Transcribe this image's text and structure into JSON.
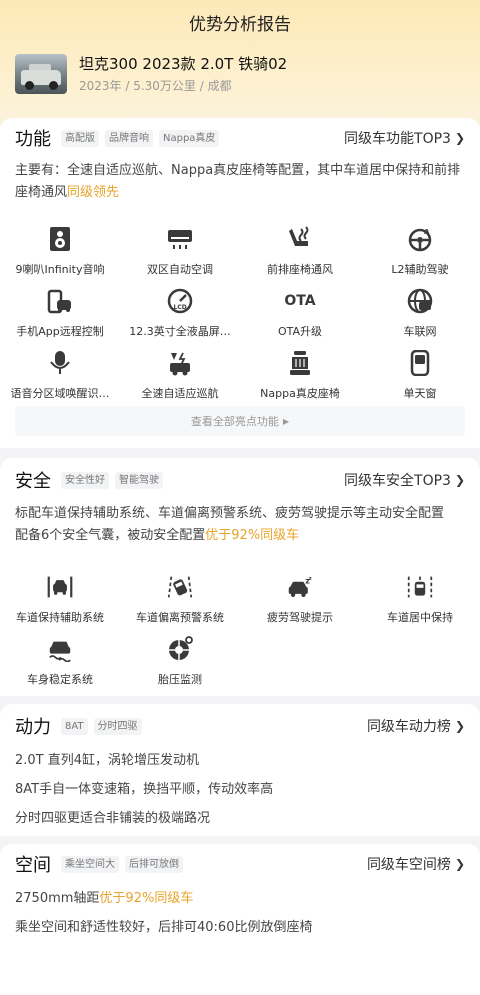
{
  "page_title": "优势分析报告",
  "car": {
    "name": "坦克300 2023款 2.0T 铁骑02",
    "meta": "2023年 / 5.30万公里 / 成都"
  },
  "features": {
    "title": "功能",
    "tags": [
      "高配版",
      "品牌音响",
      "Nappa真皮"
    ],
    "link": "同级车功能TOP3",
    "summary_main": "主要有：全速自适应巡航、Nappa真皮座椅等配置，其中车道居中保持和前排座椅通风",
    "summary_hl": "同级领先",
    "items": [
      {
        "label": "9喇叭Infinity音响",
        "icon": "speaker-icon"
      },
      {
        "label": "双区自动空调",
        "icon": "air-conditioner-icon"
      },
      {
        "label": "前排座椅通风",
        "icon": "seat-ventilation-icon"
      },
      {
        "label": "L2辅助驾驶",
        "icon": "assisted-driving-icon"
      },
      {
        "label": "手机App远程控制",
        "icon": "phone-remote-icon"
      },
      {
        "label": "12.3英寸全液晶屏…",
        "icon": "lcd-gauge-icon"
      },
      {
        "label": "OTA升级",
        "icon": "ota-icon"
      },
      {
        "label": "车联网",
        "icon": "connected-car-icon"
      },
      {
        "label": "语音分区域唤醒识…",
        "icon": "microphone-icon"
      },
      {
        "label": "全速自适应巡航",
        "icon": "adaptive-cruise-icon"
      },
      {
        "label": "Nappa真皮座椅",
        "icon": "leather-seat-icon"
      },
      {
        "label": "单天窗",
        "icon": "sunroof-icon"
      }
    ],
    "ota_text": "OTA",
    "lcd_text": "LCD",
    "see_all": "查看全部亮点功能"
  },
  "safety": {
    "title": "安全",
    "tags": [
      "安全性好",
      "智能驾驶"
    ],
    "link": "同级车安全TOP3",
    "line1": "标配车道保持辅助系统、车道偏离预警系统、疲劳驾驶提示等主动安全配置",
    "line2_main": "配备6个安全气囊，被动安全配置",
    "line2_hl": "优于92%同级车",
    "items": [
      {
        "label": "车道保持辅助系统",
        "icon": "lane-keep-icon"
      },
      {
        "label": "车道偏离预警系统",
        "icon": "lane-departure-icon"
      },
      {
        "label": "疲劳驾驶提示",
        "icon": "fatigue-alert-icon"
      },
      {
        "label": "车道居中保持",
        "icon": "lane-centering-icon"
      },
      {
        "label": "车身稳定系统",
        "icon": "stability-control-icon"
      },
      {
        "label": "胎压监测",
        "icon": "tire-pressure-icon"
      }
    ]
  },
  "power": {
    "title": "动力",
    "tags": [
      "8AT",
      "分时四驱"
    ],
    "link": "同级车动力榜",
    "lines": [
      "2.0T 直列4缸，涡轮增压发动机",
      "8AT手自一体变速箱，换挡平顺，传动效率高",
      "分时四驱更适合非铺装的极端路况"
    ]
  },
  "space": {
    "title": "空间",
    "tags": [
      "乘坐空间大",
      "后排可放倒"
    ],
    "link": "同级车空间榜",
    "line1_main": "2750mm轴距",
    "line1_hl": "优于92%同级车",
    "line2": "乘坐空间和舒适性较好，后排可40:60比例放倒座椅"
  },
  "colors": {
    "accent": "#e8a42a",
    "icon": "#3a3a3a"
  }
}
